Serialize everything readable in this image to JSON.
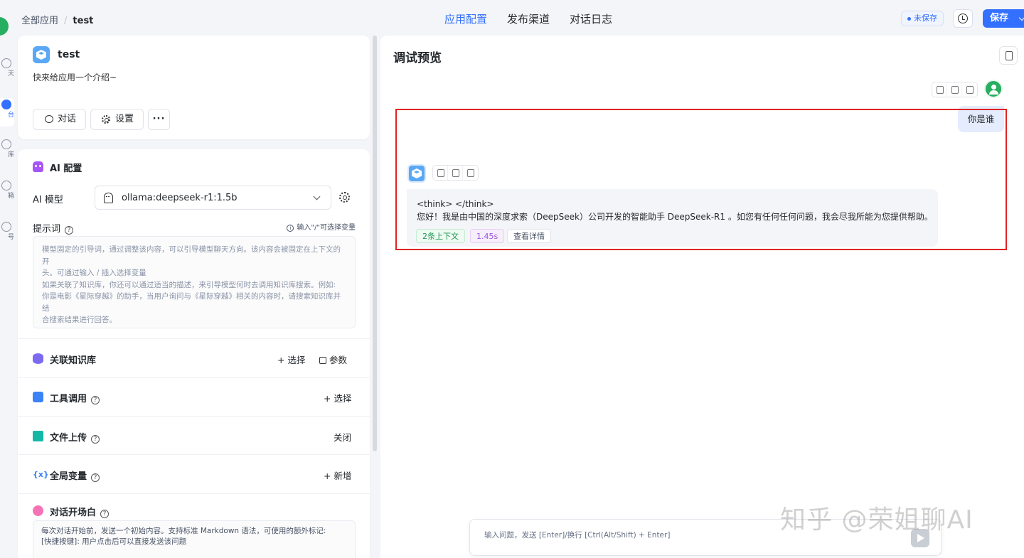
{
  "header": {
    "breadcrumb_root": "全部应用",
    "breadcrumb_current": "test",
    "tabs": [
      "应用配置",
      "发布渠道",
      "对话日志"
    ],
    "unsaved_label": "未保存",
    "save_label": "保存",
    "colors": {
      "accent": "#3370ff"
    }
  },
  "rail": {
    "items": [
      "天",
      "台",
      "库",
      "箱",
      "号"
    ]
  },
  "app": {
    "name": "test",
    "intro": "快来给应用一个介绍~",
    "chat_button": "对话",
    "settings_button": "设置",
    "more_button": "···"
  },
  "config": {
    "ai_title": "AI 配置",
    "model_label": "AI 模型",
    "model_value": "ollama:deepseek-r1:1.5b",
    "prompt_label": "提示词",
    "prompt_hint": "输入\"/\"可选择变量",
    "prompt_placeholder": "模型固定的引导词，通过调整该内容，可以引导模型聊天方向。该内容会被固定在上下文的开\n头。可通过输入 / 插入选择变量\n如果关联了知识库，你还可以通过适当的描述，来引导模型何时去调用知识库搜索。例如:\n你是电影《星际穿越》的助手，当用户询问与《星际穿越》相关的内容时，请搜索知识库并结\n合搜索结果进行回答。",
    "kb_title": "关联知识库",
    "kb_select": "+ 选择",
    "kb_params": "参数",
    "tool_title": "工具调用",
    "tool_select": "+ 选择",
    "file_title": "文件上传",
    "file_status": "关闭",
    "var_title": "全局变量",
    "var_icon": "{x}",
    "var_add": "+ 新增",
    "opening_title": "对话开场白",
    "opening_text": "每次对话开始前，发送一个初始内容。支持标准 Markdown 语法，可使用的额外标记:\n[快捷按键]: 用户点击后可以直接发送该问题"
  },
  "preview": {
    "title": "调试预览",
    "user_message": "你是谁",
    "bot_message": "<think> </think>\n您好！我是由中国的深度求索（DeepSeek）公司开发的智能助手 DeepSeek-R1 。如您有任何任何问题，我会尽我所能为您提供帮助。",
    "tag_context": "2条上下文",
    "tag_time": "1.45s",
    "tag_detail": "查看详情",
    "input_placeholder": "输入问题，发送 [Enter]/换行 [Ctrl(Alt/Shift) + Enter]"
  },
  "watermark": "知乎 @荣姐聊AI"
}
